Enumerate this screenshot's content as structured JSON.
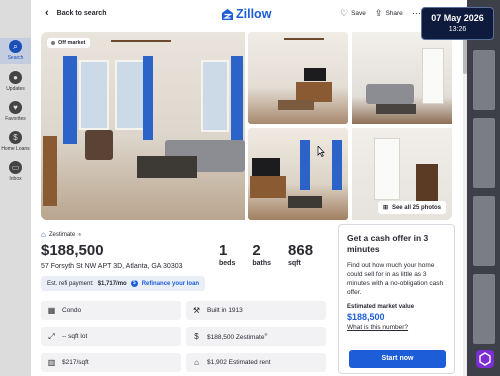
{
  "background_sidebar": {
    "items": [
      {
        "label": "Search",
        "icon": "search-icon",
        "active": true
      },
      {
        "label": "Updates",
        "icon": "bell-icon"
      },
      {
        "label": "Favorites",
        "icon": "heart-icon"
      },
      {
        "label": "Home Loans",
        "icon": "dollar-icon"
      },
      {
        "label": "Inbox",
        "icon": "inbox-icon"
      }
    ]
  },
  "header": {
    "back_label": "Back to search",
    "logo_text": "Zillow",
    "save_label": "Save",
    "share_label": "Share"
  },
  "photos": {
    "off_market_label": "Off market",
    "see_all_label": "See all 25 photos"
  },
  "listing": {
    "zestimate_label": "Zestimate",
    "zestimate_mark": "®",
    "price": "$188,500",
    "address": "57 Forsyth St NW APT 3D, Atlanta, GA 30303",
    "beds_value": "1",
    "beds_label": "beds",
    "baths_value": "2",
    "baths_label": "baths",
    "sqft_value": "868",
    "sqft_label": "sqft",
    "refi_text": "Est. refi payment:",
    "refi_amount": "$1,717/mo",
    "refi_link": "Refinance your loan"
  },
  "facts": [
    {
      "icon": "building-icon",
      "text": "Condo"
    },
    {
      "icon": "hammer-icon",
      "text": "Built in 1913"
    },
    {
      "icon": "ruler-icon",
      "text": "-- sqft lot"
    },
    {
      "icon": "dollar-icon",
      "text": "$188,500 Zestimate",
      "sup": "®"
    },
    {
      "icon": "price-icon",
      "text": "$217/sqft"
    },
    {
      "icon": "rent-icon",
      "text": "$1,902 Estimated rent"
    }
  ],
  "cash_offer": {
    "title": "Get a cash offer in 3 minutes",
    "body": "Find out how much your home could sell for in as little as 3 minutes with a no-obligation cash offer.",
    "estimated_label": "Estimated market value",
    "estimated_value": "$188,500",
    "what_link": "What is this number?",
    "start_label": "Start now"
  },
  "overlay": {
    "date": "07 May 2026",
    "time": "13:26"
  },
  "colors": {
    "brand": "#1d5ed8",
    "text": "#2a2a33"
  }
}
